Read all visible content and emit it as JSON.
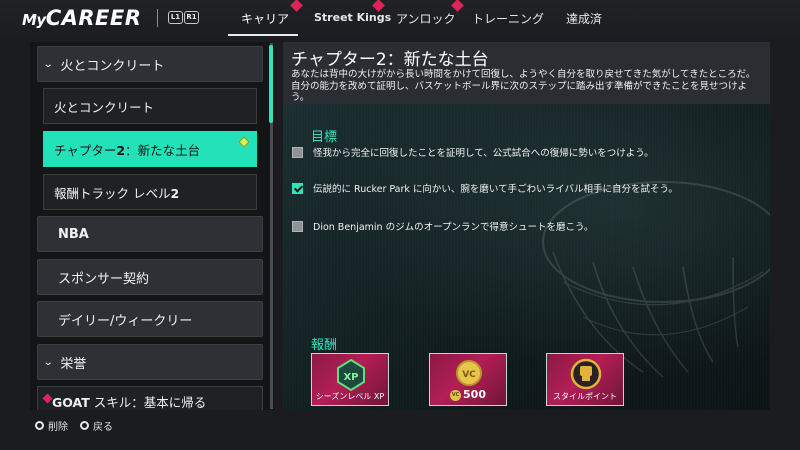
{
  "header": {
    "logo_my": "My",
    "logo_career": "CAREER",
    "l1": "L1",
    "r1": "R1",
    "tabs": [
      {
        "label": "キャリア",
        "active": true
      },
      {
        "label": "Street Kings"
      },
      {
        "label": "アンロック"
      },
      {
        "label": "トレーニング"
      },
      {
        "label": "達成済"
      }
    ]
  },
  "sidebar": {
    "section1": "火とコンクリート",
    "sub1": "火とコンクリート",
    "sub2_prefix": "チャプター",
    "sub2_num": "2",
    "sub2_suffix": "：新たな土台",
    "sub3_prefix": "報酬トラック レベル",
    "sub3_num": "2",
    "nba": "NBA",
    "sponsor": "スポンサー契約",
    "daily": "デイリー/ウィークリー",
    "section2": "栄誉",
    "goat_bold": "GOAT",
    "goat_rest": " スキル：基本に帰る"
  },
  "main": {
    "title": "チャプター2：新たな土台",
    "description": "あなたは背中の大けがから長い時間をかけて回復し、ようやく自分を取り戻せてきた気がしてきたところだ。自分の能力を改めて証明し、バスケットボール界に次のステップに踏み出す準備ができたことを見せつけよう。",
    "goals_title": "目標",
    "goals": [
      {
        "text": "怪我から完全に回復したことを証明して、公式試合への復帰に勢いをつけよう。",
        "checked": false
      },
      {
        "text": "伝説的に Rucker Park に向かい、腕を磨いて手ごわいライバル相手に自分を試そう。",
        "checked": true
      },
      {
        "text": "Dion Benjamin のジムのオープンランで得意シュートを磨こう。",
        "checked": false
      }
    ],
    "rewards_title": "報酬",
    "rewards": [
      {
        "label": "シーズンレベル XP",
        "icon": "xp-icon"
      },
      {
        "value": "500",
        "coin": "VC",
        "icon": "vc-coin-icon"
      },
      {
        "label": "スタイルポイント",
        "icon": "style-points-icon"
      }
    ]
  },
  "footer": {
    "delete": "削除",
    "back": "戻る"
  },
  "colors": {
    "accent": "#23e1b8",
    "notification": "#e0225a",
    "reward_bg": "#b31e56"
  }
}
